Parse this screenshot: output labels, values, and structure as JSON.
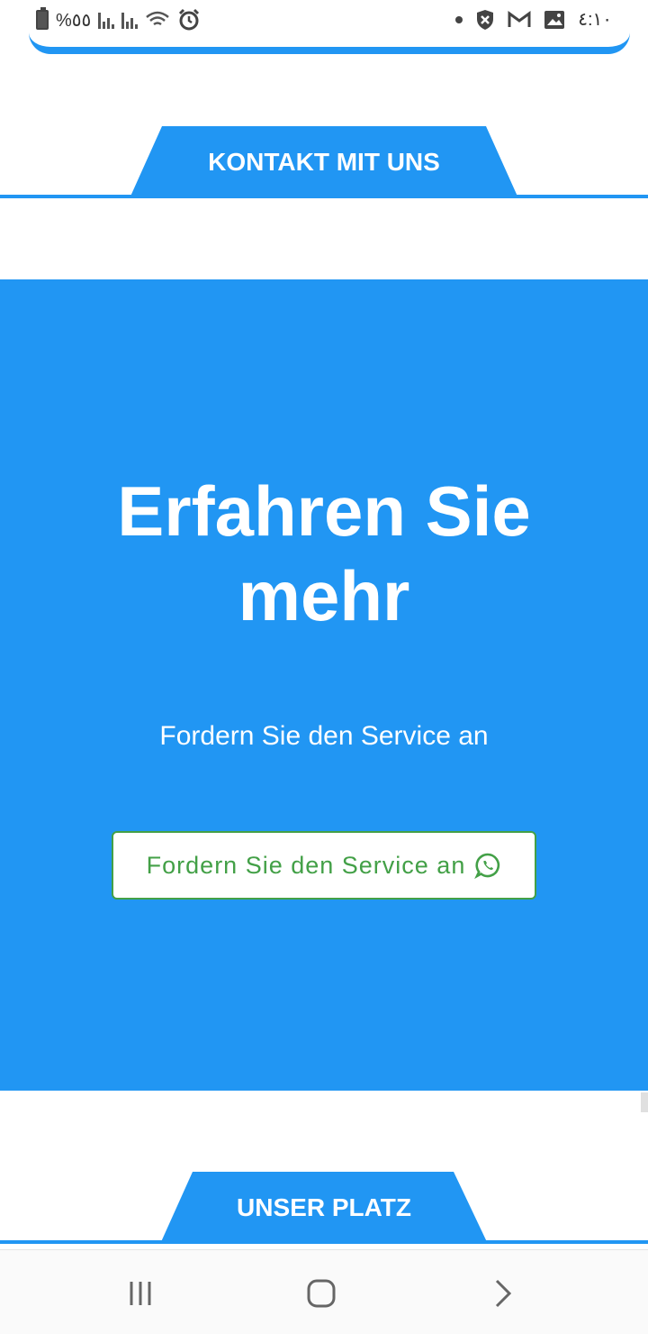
{
  "status_bar": {
    "battery_text": "%٥٥",
    "time": "٤:١٠"
  },
  "sections": {
    "contact_label": "KONTAKT MIT UNS",
    "place_label": "UNSER PLATZ"
  },
  "hero": {
    "title": "Erfahren Sie mehr",
    "subtitle": "Fordern Sie den Service an",
    "button_label": "Fordern Sie den Service an"
  },
  "colors": {
    "accent": "#2196F3",
    "button_green": "#43A047"
  }
}
